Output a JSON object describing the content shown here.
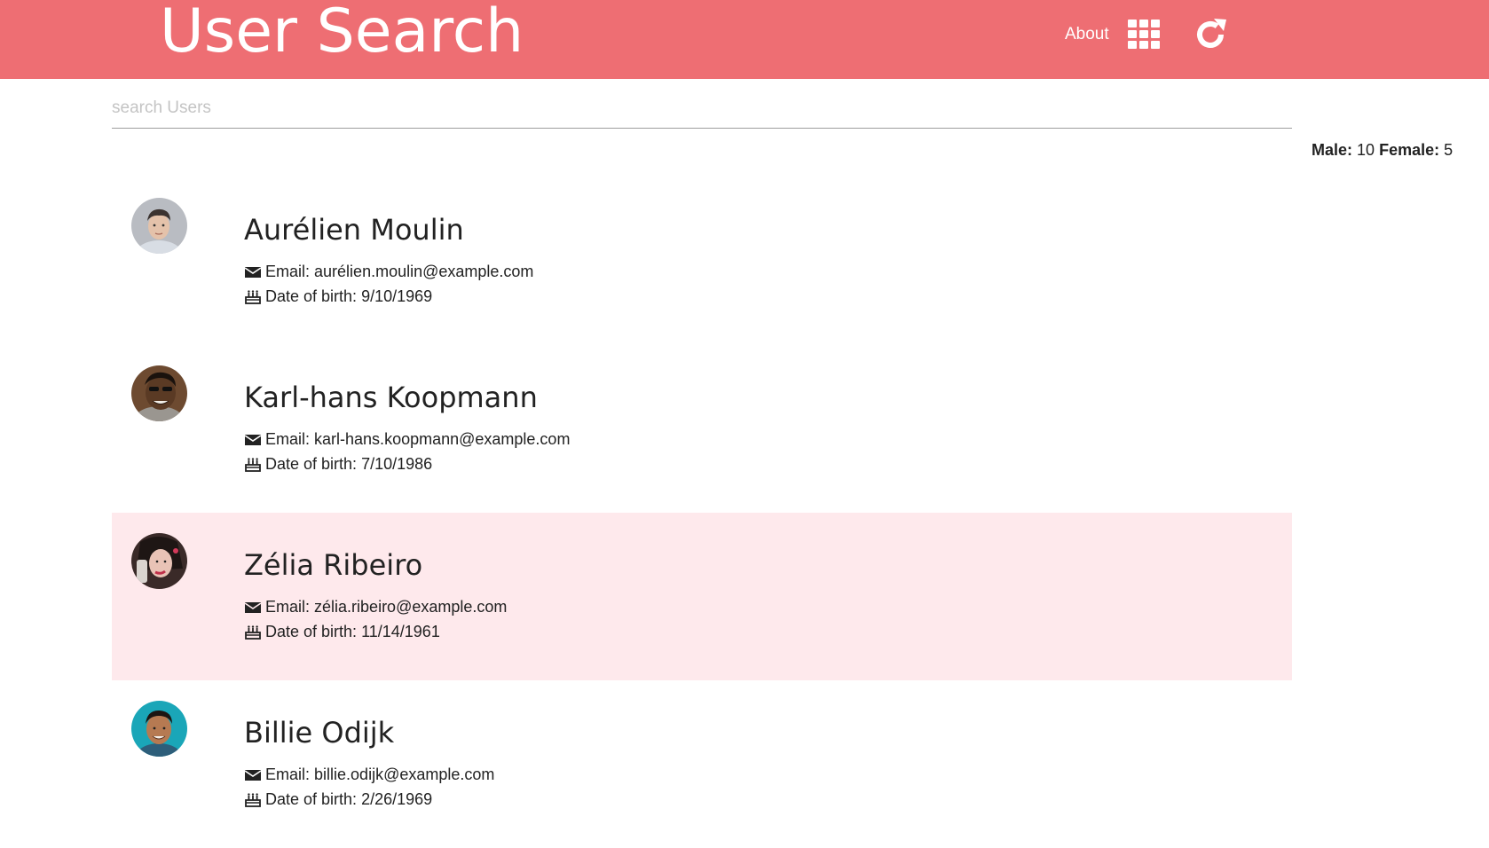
{
  "header": {
    "title": "User Search",
    "about_label": "About",
    "grid_icon": "apps-grid-icon",
    "refresh_icon": "refresh-icon",
    "bg_color": "#ee6e73"
  },
  "search": {
    "placeholder": "search Users",
    "value": ""
  },
  "stats": {
    "male_label": "Male:",
    "male_count": "10",
    "female_label": "Female:",
    "female_count": "5"
  },
  "users": [
    {
      "name": "Aurélien Moulin",
      "email_label": "Email:",
      "email": "aurélien.moulin@example.com",
      "dob_label": "Date of birth:",
      "dob": "9/10/1969",
      "highlighted": false
    },
    {
      "name": "Karl-hans Koopmann",
      "email_label": "Email:",
      "email": "karl-hans.koopmann@example.com",
      "dob_label": "Date of birth:",
      "dob": "7/10/1986",
      "highlighted": false
    },
    {
      "name": "Zélia Ribeiro",
      "email_label": "Email:",
      "email": "zélia.ribeiro@example.com",
      "dob_label": "Date of birth:",
      "dob": "11/14/1961",
      "highlighted": true
    },
    {
      "name": "Billie Odijk",
      "email_label": "Email:",
      "email": "billie.odijk@example.com",
      "dob_label": "Date of birth:",
      "dob": "2/26/1969",
      "highlighted": false
    }
  ],
  "colors": {
    "highlight_row": "#fee9ec",
    "accent": "#ee6e73"
  }
}
